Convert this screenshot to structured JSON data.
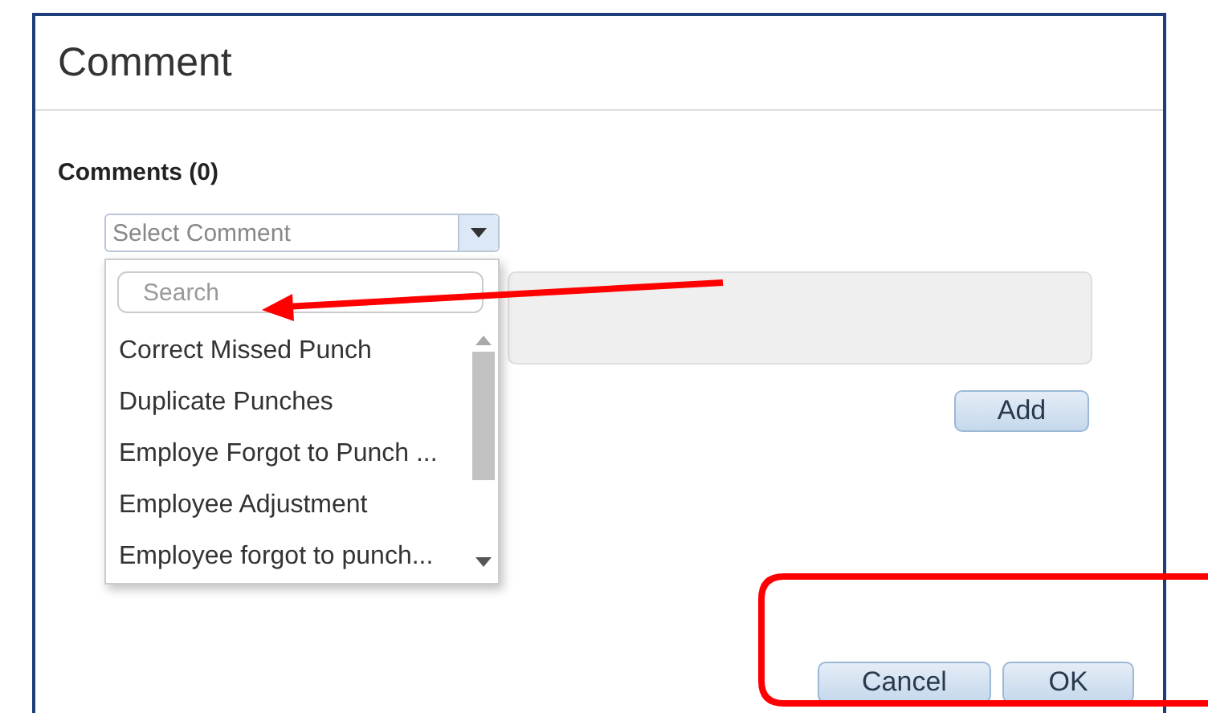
{
  "dialog": {
    "title": "Comment",
    "comments_label": "Comments (0)",
    "select": {
      "placeholder": "Select Comment",
      "expanded": true
    },
    "dropdown": {
      "search_placeholder": "Search",
      "items": [
        "Correct Missed Punch",
        "Duplicate Punches",
        "Employe Forgot to Punch ...",
        "Employee Adjustment",
        "Employee forgot to punch..."
      ]
    },
    "add_button": "Add",
    "buttons": [
      "Cancel",
      "OK"
    ]
  }
}
